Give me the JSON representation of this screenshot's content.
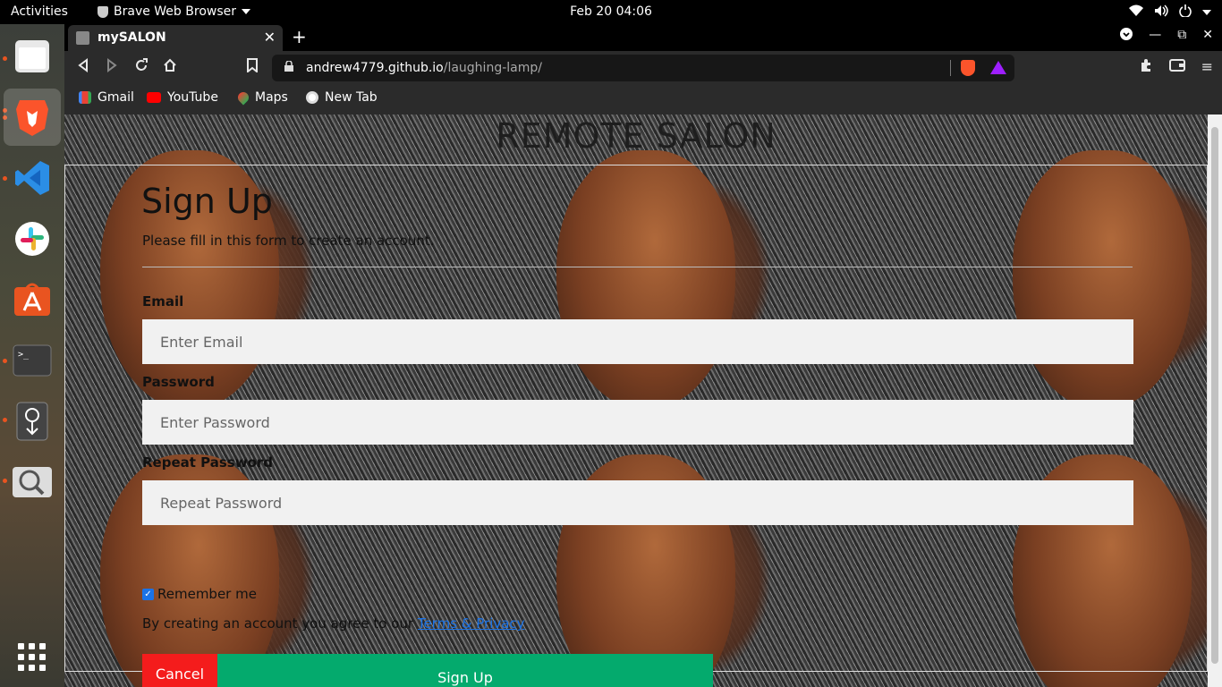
{
  "topbar": {
    "activities": "Activities",
    "app_name": "Brave Web Browser",
    "clock": "Feb 20  04:06"
  },
  "dock": {
    "items": [
      "files-icon",
      "brave-icon",
      "vscode-icon",
      "slack-icon",
      "app-center-icon",
      "terminal-icon",
      "privacy-icon",
      "screenshot-icon",
      "app-grid-icon"
    ]
  },
  "browser": {
    "tab_title": "mySALON",
    "url_host": "andrew4779.github.io",
    "url_path": "/laughing-lamp/",
    "bookmarks": [
      "Gmail",
      "YouTube",
      "Maps",
      "New Tab"
    ]
  },
  "page": {
    "site_title": "REMOTE SALON",
    "form_title": "Sign Up",
    "form_subtitle": "Please fill in this form to create an account.",
    "email_label": "Email",
    "email_placeholder": "Enter Email",
    "password_label": "Password",
    "password_placeholder": "Enter Password",
    "repeat_label": "Repeat Password",
    "repeat_placeholder": "Repeat Password",
    "remember_label": "Remember me",
    "terms_text": "By creating an account you agree to our ",
    "terms_link": "Terms & Privacy",
    "cancel_label": "Cancel",
    "signup_label": "Sign Up"
  },
  "colors": {
    "cancel": "#f41c1c",
    "signup": "#04aa6d",
    "link": "#1a73e8"
  }
}
